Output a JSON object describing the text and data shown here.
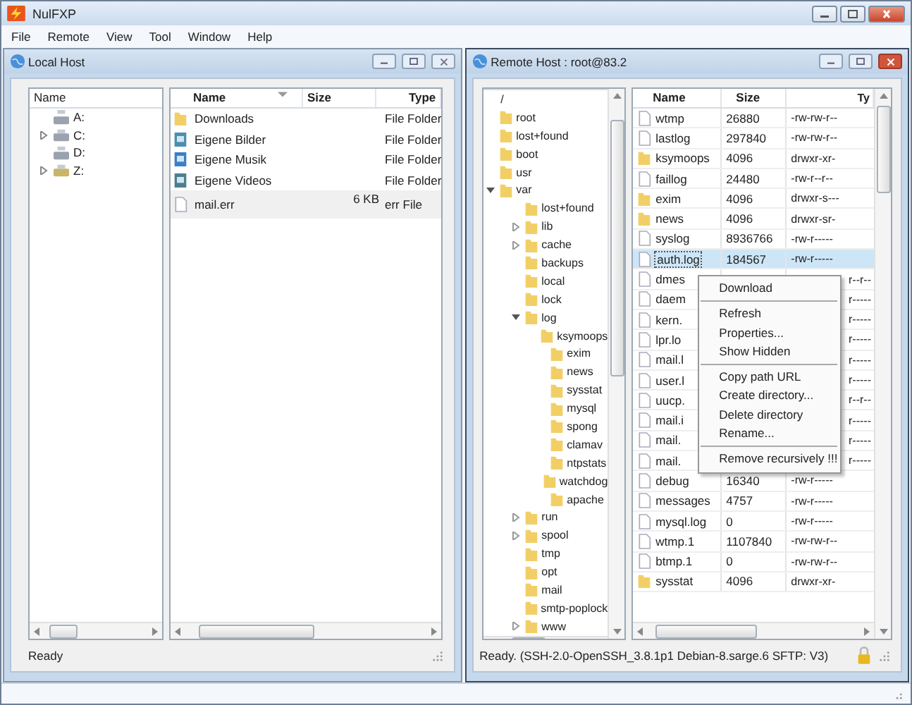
{
  "window": {
    "title": "NulFXP"
  },
  "menu": [
    "File",
    "Remote",
    "View",
    "Tool",
    "Window",
    "Help"
  ],
  "local": {
    "title": "Local Host",
    "tree": {
      "header": "Name",
      "items": [
        {
          "label": "A:",
          "kind": "floppy"
        },
        {
          "label": "C:",
          "kind": "drive",
          "expanded": false
        },
        {
          "label": "D:",
          "kind": "cdrom"
        },
        {
          "label": "Z:",
          "kind": "network",
          "expanded": false
        }
      ]
    },
    "files": {
      "columns": [
        "Name",
        "Size",
        "Type"
      ],
      "rows": [
        {
          "name": "Downloads",
          "type": "File Folder",
          "kind": "folder",
          "selected": false
        },
        {
          "name": "Eigene Bilder",
          "type": "File Folder",
          "kind": "pictures",
          "selected": false
        },
        {
          "name": "Eigene Musik",
          "type": "File Folder",
          "kind": "music",
          "selected": false
        },
        {
          "name": "Eigene Videos",
          "type": "File Folder",
          "kind": "video",
          "selected": false
        },
        {
          "name": "mail.err",
          "size": "6 KB",
          "type": "err File",
          "kind": "file",
          "selected": true
        }
      ]
    },
    "status": "Ready"
  },
  "remote": {
    "title": "Remote Host : root@83.2",
    "tree": [
      {
        "label": "/",
        "children": [
          {
            "label": "root"
          },
          {
            "label": "lost+found"
          },
          {
            "label": "boot"
          },
          {
            "label": "usr"
          },
          {
            "label": "var",
            "expanded": true,
            "children": [
              {
                "label": "lost+found"
              },
              {
                "label": "lib",
                "expanded": false
              },
              {
                "label": "cache",
                "expanded": false
              },
              {
                "label": "backups"
              },
              {
                "label": "local"
              },
              {
                "label": "lock"
              },
              {
                "label": "log",
                "expanded": true,
                "children": [
                  {
                    "label": "ksymoops"
                  },
                  {
                    "label": "exim"
                  },
                  {
                    "label": "news"
                  },
                  {
                    "label": "sysstat"
                  },
                  {
                    "label": "mysql"
                  },
                  {
                    "label": "spong"
                  },
                  {
                    "label": "clamav"
                  },
                  {
                    "label": "ntpstats"
                  },
                  {
                    "label": "watchdog"
                  },
                  {
                    "label": "apache"
                  }
                ]
              },
              {
                "label": "run",
                "expanded": false
              },
              {
                "label": "spool",
                "expanded": false
              },
              {
                "label": "tmp"
              },
              {
                "label": "opt"
              },
              {
                "label": "mail"
              },
              {
                "label": "smtp-poplock"
              },
              {
                "label": "www",
                "expanded": false
              }
            ]
          }
        ]
      }
    ],
    "files": {
      "columns": [
        "Name",
        "Size",
        "Ty"
      ],
      "rows": [
        {
          "name": "wtmp",
          "size": "26880",
          "type": "-rw-rw-r--",
          "kind": "file",
          "selected": false
        },
        {
          "name": "lastlog",
          "size": "297840",
          "type": "-rw-rw-r--",
          "kind": "file",
          "selected": false
        },
        {
          "name": "ksymoops",
          "size": "4096",
          "type": "drwxr-xr-",
          "kind": "folder",
          "selected": false
        },
        {
          "name": "faillog",
          "size": "24480",
          "type": "-rw-r--r--",
          "kind": "file",
          "selected": false
        },
        {
          "name": "exim",
          "size": "4096",
          "type": "drwxr-s---",
          "kind": "folder",
          "selected": false
        },
        {
          "name": "news",
          "size": "4096",
          "type": "drwxr-sr-",
          "kind": "folder",
          "selected": false
        },
        {
          "name": "syslog",
          "size": "8936766",
          "type": "-rw-r-----",
          "kind": "file",
          "selected": false
        },
        {
          "name": "auth.log",
          "size": "184567",
          "type": "-rw-r-----",
          "kind": "file",
          "selected": true
        },
        {
          "name": "dmes",
          "type": "r--r--",
          "kind": "file",
          "selected": false
        },
        {
          "name": "daem",
          "type": "r-----",
          "kind": "file",
          "selected": false
        },
        {
          "name": "kern.",
          "type": "r-----",
          "kind": "file",
          "selected": false
        },
        {
          "name": "lpr.lo",
          "type": "r-----",
          "kind": "file",
          "selected": false
        },
        {
          "name": "mail.l",
          "type": "r-----",
          "kind": "file",
          "selected": false
        },
        {
          "name": "user.l",
          "type": "r-----",
          "kind": "file",
          "selected": false
        },
        {
          "name": "uucp.",
          "type": "r--r--",
          "kind": "file",
          "selected": false
        },
        {
          "name": "mail.i",
          "type": "r-----",
          "kind": "file",
          "selected": false
        },
        {
          "name": "mail.",
          "type": "r-----",
          "kind": "file",
          "selected": false
        },
        {
          "name": "mail.",
          "type": "r-----",
          "kind": "file",
          "selected": false
        },
        {
          "name": "debug",
          "size": "16340",
          "type": "-rw-r-----",
          "kind": "file",
          "selected": false
        },
        {
          "name": "messages",
          "size": "4757",
          "type": "-rw-r-----",
          "kind": "file",
          "selected": false
        },
        {
          "name": "mysql.log",
          "size": "0",
          "type": "-rw-r-----",
          "kind": "file",
          "selected": false
        },
        {
          "name": "wtmp.1",
          "size": "1107840",
          "type": "-rw-rw-r--",
          "kind": "file",
          "selected": false
        },
        {
          "name": "btmp.1",
          "size": "0",
          "type": "-rw-rw-r--",
          "kind": "file",
          "selected": false
        },
        {
          "name": "sysstat",
          "size": "4096",
          "type": "drwxr-xr-",
          "kind": "folder",
          "selected": false
        }
      ]
    },
    "context_menu": [
      {
        "kind": "item",
        "label": "Download"
      },
      {
        "kind": "separator"
      },
      {
        "kind": "item",
        "label": "Refresh"
      },
      {
        "kind": "item",
        "label": "Properties..."
      },
      {
        "kind": "item",
        "label": "Show Hidden"
      },
      {
        "kind": "separator"
      },
      {
        "kind": "item",
        "label": "Copy path URL"
      },
      {
        "kind": "item",
        "label": "Create directory..."
      },
      {
        "kind": "item",
        "label": "Delete directory"
      },
      {
        "kind": "item",
        "label": "Rename..."
      },
      {
        "kind": "separator"
      },
      {
        "kind": "item",
        "label": "Remove recursively !!!"
      }
    ],
    "status": "Ready. (SSH-2.0-OpenSSH_3.8.1p1 Debian-8.sarge.6  SFTP: V3)"
  }
}
